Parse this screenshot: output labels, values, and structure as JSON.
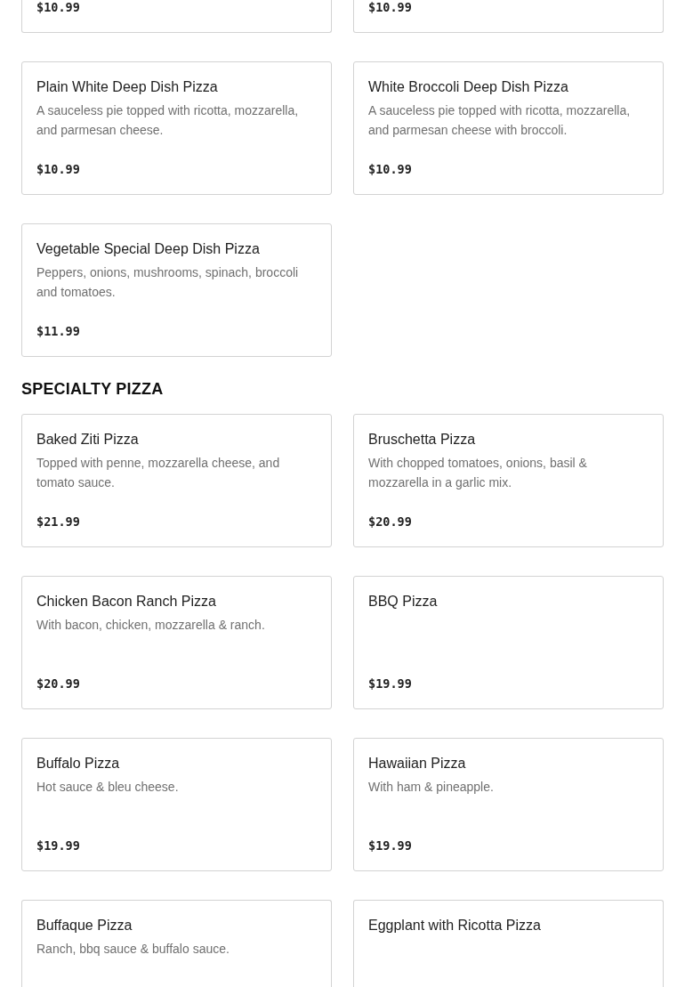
{
  "sections": [
    {
      "items": [
        {
          "kind": "partial_top",
          "price": "$10.99"
        },
        {
          "kind": "partial_top",
          "price": "$10.99"
        },
        {
          "kind": "full",
          "name": "Plain White Deep Dish Pizza",
          "description": "A sauceless pie topped with ricotta, mozzarella, and parmesan cheese.",
          "price": "$10.99"
        },
        {
          "kind": "full",
          "name": "White Broccoli Deep Dish Pizza",
          "description": "A sauceless pie topped with ricotta, mozzarella, and parmesan cheese with broccoli.",
          "price": "$10.99"
        },
        {
          "kind": "full",
          "name": "Vegetable Special Deep Dish Pizza",
          "description": "Peppers, onions, mushrooms, spinach, broccoli and tomatoes.",
          "price": "$11.99"
        }
      ]
    },
    {
      "title": "SPECIALTY PIZZA",
      "items": [
        {
          "kind": "full",
          "name": "Baked Ziti Pizza",
          "description": "Topped with penne, mozzarella cheese, and tomato sauce.",
          "price": "$21.99"
        },
        {
          "kind": "full",
          "name": "Bruschetta Pizza",
          "description": "With chopped tomatoes, onions, basil & mozzarella in a garlic mix.",
          "price": "$20.99"
        },
        {
          "kind": "full",
          "name": "Chicken Bacon Ranch Pizza",
          "description": "With bacon, chicken, mozzarella & ranch.",
          "price": "$20.99"
        },
        {
          "kind": "full",
          "name": "BBQ Pizza",
          "price": "$19.99"
        },
        {
          "kind": "full",
          "name": "Buffalo Pizza",
          "description": "Hot sauce & bleu cheese.",
          "price": "$19.99"
        },
        {
          "kind": "full",
          "name": "Hawaiian Pizza",
          "description": "With ham & pineapple.",
          "price": "$19.99"
        },
        {
          "kind": "partial_bottom",
          "name": "Buffaque Pizza",
          "description": "Ranch, bbq sauce & buffalo sauce."
        },
        {
          "kind": "partial_bottom",
          "name": "Eggplant with Ricotta Pizza"
        }
      ]
    }
  ]
}
